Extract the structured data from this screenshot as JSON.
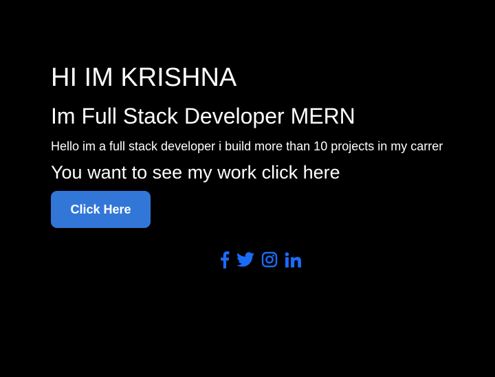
{
  "hero": {
    "title": "HI IM KRISHNA",
    "subtitle": "Im Full Stack Developer MERN",
    "intro": "Hello im a full stack developer i build more than 10 projects in my carrer",
    "cta_text": "You want to see my work click here",
    "button_label": "Click Here"
  },
  "socials": [
    {
      "icon": "facebook-icon"
    },
    {
      "icon": "twitter-icon"
    },
    {
      "icon": "instagram-icon"
    },
    {
      "icon": "linkedin-icon"
    }
  ],
  "colors": {
    "background": "#000000",
    "text": "#ffffff",
    "button": "#3277d8",
    "social": "#1a6cf5"
  }
}
